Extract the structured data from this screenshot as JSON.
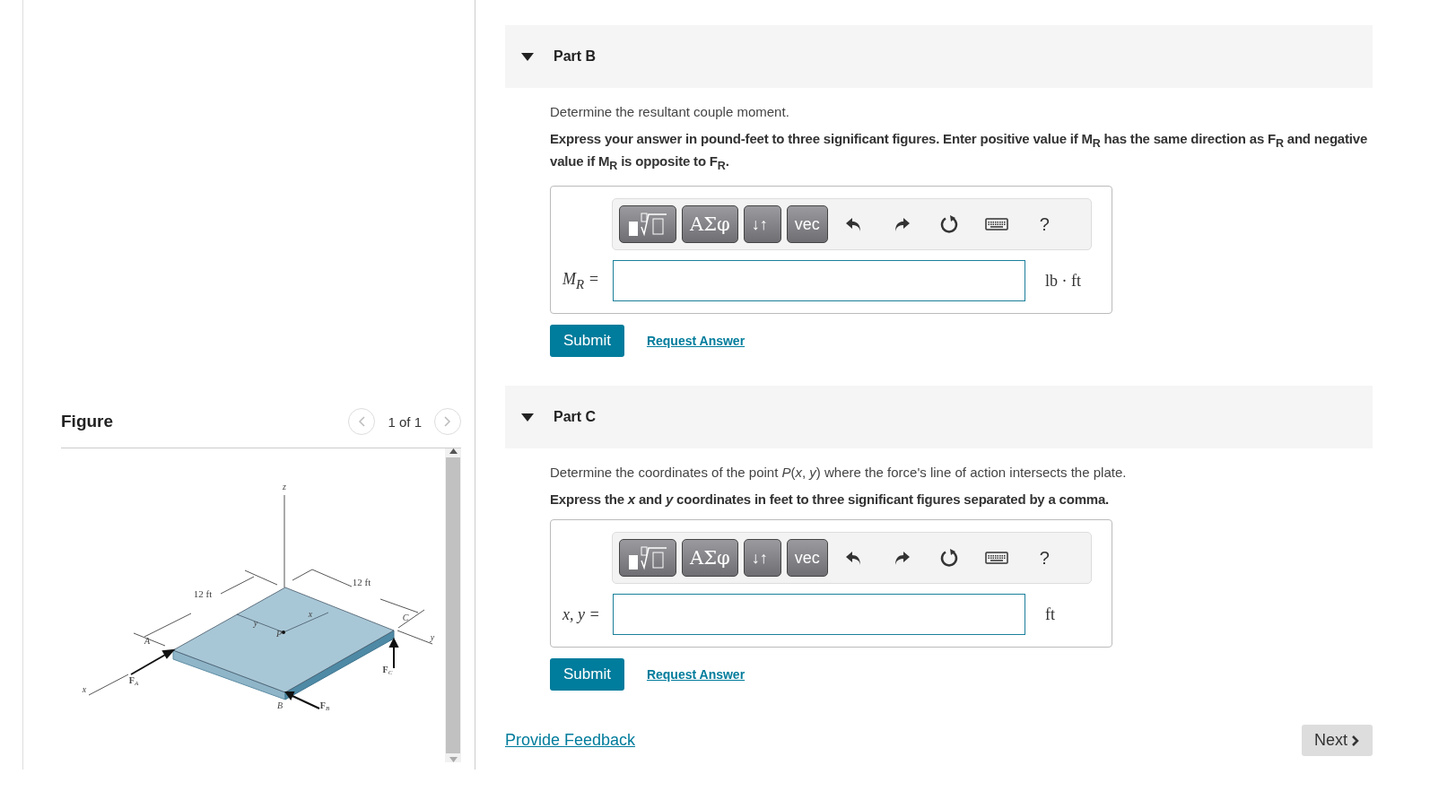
{
  "figure": {
    "title": "Figure",
    "pager": "1 of 1",
    "labels": [
      {
        "text": "z"
      },
      {
        "text": "12 ft"
      },
      {
        "text": "12 ft"
      },
      {
        "text": "y"
      },
      {
        "text": "x"
      },
      {
        "text": "P"
      },
      {
        "text": "A"
      },
      {
        "text": "C"
      },
      {
        "text": "y"
      },
      {
        "text": "x"
      },
      {
        "text": "B"
      },
      {
        "text": "F",
        "sub": "A"
      },
      {
        "text": "F",
        "sub": "B"
      },
      {
        "text": "F",
        "sub": "C"
      }
    ]
  },
  "parts": [
    {
      "title": "Part B",
      "expanded": true,
      "prompt": "Determine the resultant couple moment.",
      "instruction": "Express your answer in pound-feet to three significant figures. Enter positive value if M$_{R}$ has the same direction as F$_{R}$ and negative value if M$_{R}$ is opposite to F$_{R}$.",
      "toolbar": [
        {
          "kind": "templates"
        },
        {
          "kind": "text",
          "label": "ΑΣφ"
        },
        {
          "kind": "text",
          "label": "↓↑"
        },
        {
          "kind": "text",
          "label": "vec"
        },
        {
          "kind": "undo"
        },
        {
          "kind": "redo"
        },
        {
          "kind": "reset"
        },
        {
          "kind": "keyboard"
        },
        {
          "kind": "help",
          "label": "?"
        }
      ],
      "answer_label": "M$_{R}$ =",
      "unit": "lb · ft",
      "submit": "Submit",
      "request": "Request Answer"
    },
    {
      "title": "Part C",
      "expanded": true,
      "prompt": "Determine the coordinates of the point *P*(*x*, *y*) where the force's line of action intersects the plate.",
      "instruction": "Express the *x* and *y* coordinates in feet to three significant figures separated by a comma.",
      "toolbar": [
        {
          "kind": "templates"
        },
        {
          "kind": "text",
          "label": "ΑΣφ"
        },
        {
          "kind": "text",
          "label": "↓↑"
        },
        {
          "kind": "text",
          "label": "vec"
        },
        {
          "kind": "undo"
        },
        {
          "kind": "redo"
        },
        {
          "kind": "reset"
        },
        {
          "kind": "keyboard"
        },
        {
          "kind": "help",
          "label": "?"
        }
      ],
      "answer_label": "x, y =",
      "unit": "ft",
      "submit": "Submit",
      "request": "Request Answer"
    }
  ],
  "feedback": "Provide Feedback",
  "next": "Next"
}
